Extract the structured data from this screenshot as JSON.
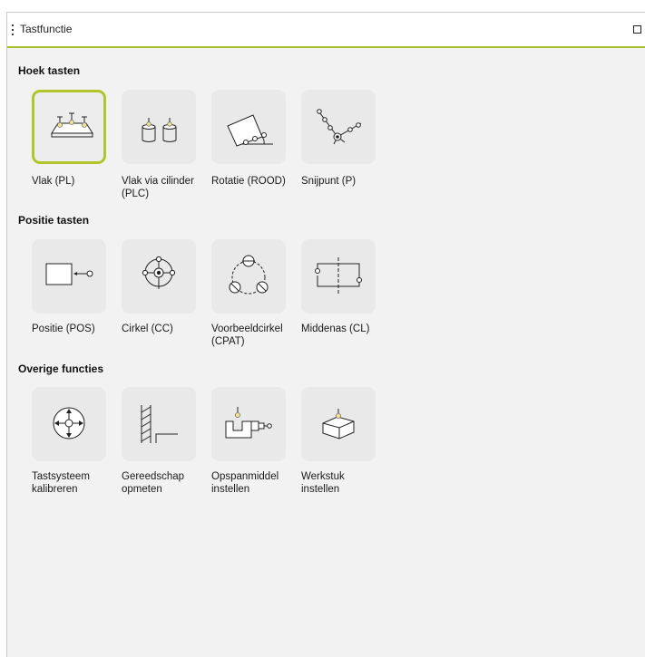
{
  "window": {
    "title": "Tastfunctie"
  },
  "colors": {
    "accent": "#a9c22c",
    "tile_background": "#e9e9e9",
    "panel_background": "#f2f2f2"
  },
  "sections": [
    {
      "title": "Hoek tasten",
      "items": [
        {
          "label_line1": "Vlak (PL)",
          "label_line2": "",
          "icon": "plane-icon",
          "selected": true
        },
        {
          "label_line1": "Vlak via cilinder",
          "label_line2": "(PLC)",
          "icon": "plane-via-cylinder-icon",
          "selected": false
        },
        {
          "label_line1": "Rotatie (ROOD)",
          "label_line2": "",
          "icon": "rotation-icon",
          "selected": false
        },
        {
          "label_line1": "Snijpunt (P)",
          "label_line2": "",
          "icon": "intersection-point-icon",
          "selected": false
        }
      ]
    },
    {
      "title": "Positie tasten",
      "items": [
        {
          "label_line1": "Positie (POS)",
          "label_line2": "",
          "icon": "position-icon",
          "selected": false
        },
        {
          "label_line1": "Cirkel (CC)",
          "label_line2": "",
          "icon": "circle-icon",
          "selected": false
        },
        {
          "label_line1": "Voorbeeldcirkel",
          "label_line2": "(CPAT)",
          "icon": "circle-pattern-icon",
          "selected": false
        },
        {
          "label_line1": "Middenas (CL)",
          "label_line2": "",
          "icon": "center-line-icon",
          "selected": false
        }
      ]
    },
    {
      "title": "Overige functies",
      "items": [
        {
          "label_line1": "Tastsysteem",
          "label_line2": "kalibreren",
          "icon": "calibrate-probe-icon",
          "selected": false
        },
        {
          "label_line1": "Gereedschap",
          "label_line2": "opmeten",
          "icon": "measure-tool-icon",
          "selected": false
        },
        {
          "label_line1": "Opspanmiddel",
          "label_line2": "instellen",
          "icon": "fixture-setup-icon",
          "selected": false
        },
        {
          "label_line1": "Werkstuk",
          "label_line2": "instellen",
          "icon": "workpiece-setup-icon",
          "selected": false
        }
      ]
    }
  ]
}
